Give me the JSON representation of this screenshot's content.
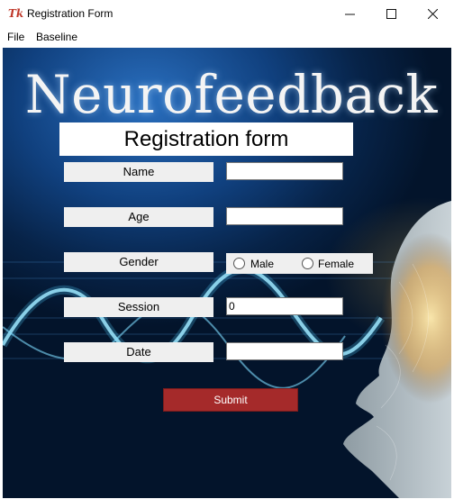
{
  "window": {
    "title": "Registration Form",
    "app_icon_text": "Tk"
  },
  "menu": [
    "File",
    "Baseline"
  ],
  "banner": "Neurofeedback",
  "form": {
    "title": "Registration form",
    "fields": {
      "name": {
        "label": "Name",
        "value": ""
      },
      "age": {
        "label": "Age",
        "value": ""
      },
      "gender": {
        "label": "Gender",
        "options": [
          "Male",
          "Female"
        ]
      },
      "session": {
        "label": "Session",
        "value": "0"
      },
      "date": {
        "label": "Date",
        "value": ""
      }
    },
    "submit_label": "Submit"
  },
  "colors": {
    "submit": "#a52a2a",
    "background": "#0b3a72"
  }
}
